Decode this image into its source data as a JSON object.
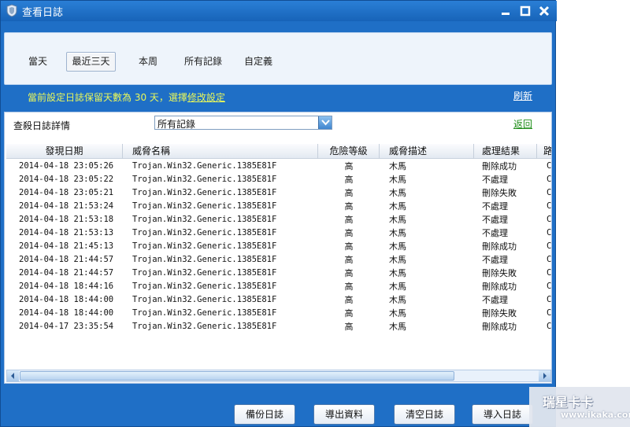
{
  "window": {
    "title": "查看日誌"
  },
  "tabs": [
    {
      "label": "當天"
    },
    {
      "label": "最近三天"
    },
    {
      "label": "本周"
    },
    {
      "label": "所有記錄"
    },
    {
      "label": "自定義"
    }
  ],
  "active_tab": "最近三天",
  "info": {
    "prefix": "當前設定日誌保留天數為 30 天，選擇",
    "link": "修改設定"
  },
  "refresh_label": "刷新",
  "filter": {
    "label": "查殺日誌詳情",
    "value": "所有記錄"
  },
  "back_label": "返回",
  "columns": [
    "發現日期",
    "威脅名稱",
    "危險等級",
    "威脅描述",
    "處理結果",
    "路"
  ],
  "rows": [
    {
      "date": "2014-04-18 23:05:26",
      "name": "Trojan.Win32.Generic.1385E81F",
      "level": "高",
      "desc": "木馬",
      "result": "刪除成功",
      "path": "C"
    },
    {
      "date": "2014-04-18 23:05:22",
      "name": "Trojan.Win32.Generic.1385E81F",
      "level": "高",
      "desc": "木馬",
      "result": "不處理",
      "path": "C"
    },
    {
      "date": "2014-04-18 23:05:21",
      "name": "Trojan.Win32.Generic.1385E81F",
      "level": "高",
      "desc": "木馬",
      "result": "刪除失敗",
      "path": "C"
    },
    {
      "date": "2014-04-18 21:53:24",
      "name": "Trojan.Win32.Generic.1385E81F",
      "level": "高",
      "desc": "木馬",
      "result": "不處理",
      "path": "C"
    },
    {
      "date": "2014-04-18 21:53:18",
      "name": "Trojan.Win32.Generic.1385E81F",
      "level": "高",
      "desc": "木馬",
      "result": "不處理",
      "path": "C"
    },
    {
      "date": "2014-04-18 21:53:13",
      "name": "Trojan.Win32.Generic.1385E81F",
      "level": "高",
      "desc": "木馬",
      "result": "不處理",
      "path": "C"
    },
    {
      "date": "2014-04-18 21:45:13",
      "name": "Trojan.Win32.Generic.1385E81F",
      "level": "高",
      "desc": "木馬",
      "result": "刪除成功",
      "path": "C"
    },
    {
      "date": "2014-04-18 21:44:57",
      "name": "Trojan.Win32.Generic.1385E81F",
      "level": "高",
      "desc": "木馬",
      "result": "不處理",
      "path": "C"
    },
    {
      "date": "2014-04-18 21:44:57",
      "name": "Trojan.Win32.Generic.1385E81F",
      "level": "高",
      "desc": "木馬",
      "result": "刪除失敗",
      "path": "C"
    },
    {
      "date": "2014-04-18 18:44:16",
      "name": "Trojan.Win32.Generic.1385E81F",
      "level": "高",
      "desc": "木馬",
      "result": "刪除成功",
      "path": "C"
    },
    {
      "date": "2014-04-18 18:44:00",
      "name": "Trojan.Win32.Generic.1385E81F",
      "level": "高",
      "desc": "木馬",
      "result": "不處理",
      "path": "C"
    },
    {
      "date": "2014-04-18 18:44:00",
      "name": "Trojan.Win32.Generic.1385E81F",
      "level": "高",
      "desc": "木馬",
      "result": "刪除失敗",
      "path": "C"
    },
    {
      "date": "2014-04-17 23:35:54",
      "name": "Trojan.Win32.Generic.1385E81F",
      "level": "高",
      "desc": "木馬",
      "result": "刪除成功",
      "path": "C"
    }
  ],
  "footer_buttons": [
    {
      "label": "備份日誌"
    },
    {
      "label": "導出資料"
    },
    {
      "label": "清空日誌"
    },
    {
      "label": "導入日誌"
    }
  ],
  "watermark": {
    "text": "瑞星卡卡",
    "url": "www.ikaka.com"
  },
  "colors": {
    "window_bg": "#1f6fc6",
    "info_text": "#e8f75a",
    "back_link": "#1e8d18"
  },
  "icons": [
    "shield-icon",
    "minimize-icon",
    "maximize-icon",
    "close-icon",
    "dropdown-arrow-icon",
    "scroll-left-icon",
    "scroll-right-icon"
  ]
}
